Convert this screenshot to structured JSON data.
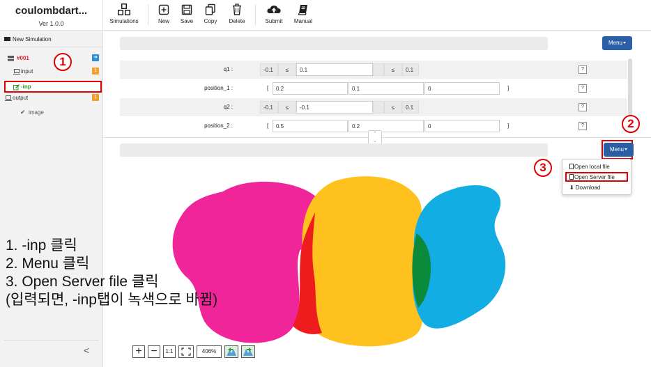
{
  "app": {
    "title": "coulombdart...",
    "version": "Ver 1.0.0"
  },
  "toolbar": [
    {
      "label": "Simulations",
      "icon": "cubes-icon"
    },
    {
      "label": "New",
      "icon": "plus-square-icon"
    },
    {
      "label": "Save",
      "icon": "floppy-icon"
    },
    {
      "label": "Copy",
      "icon": "copy-icon"
    },
    {
      "label": "Delete",
      "icon": "trash-icon"
    },
    {
      "label": "Submit",
      "icon": "cloud-upload-icon"
    },
    {
      "label": "Manual",
      "icon": "book-icon"
    }
  ],
  "sidebar": {
    "new_simulation": "New Simulation",
    "sim_id": "#001",
    "input_label": "input",
    "input_badge": "1",
    "inp_label": "-inp",
    "output_label": "output",
    "output_badge": "1",
    "image_label": "image",
    "collapse": "<"
  },
  "callouts": {
    "one": "1",
    "two": "2",
    "three": "3"
  },
  "params": {
    "menu": "Menu",
    "rows": [
      {
        "label": "q1 :",
        "min": "-0.1",
        "le1": "≤",
        "value": "0.1",
        "le2": "≤",
        "max": "0.1",
        "help": "?"
      },
      {
        "label": "position_1 :",
        "open": "[",
        "x": "0.2",
        "y": "0.1",
        "z": "0",
        "close": "]",
        "help": "?"
      },
      {
        "label": "q2 :",
        "min": "-0.1",
        "le1": "≤",
        "value": "-0.1",
        "le2": "≤",
        "max": "0.1",
        "help": "?"
      },
      {
        "label": "position_2 :",
        "open": "[",
        "x": "0.5",
        "y": "0.2",
        "z": "0",
        "close": "]",
        "help": "?"
      }
    ]
  },
  "viewer": {
    "menu": "Menu",
    "dropdown": [
      "Open local file",
      "Open Server file",
      "Download"
    ],
    "zoom": {
      "plus": "+",
      "minus": "−",
      "one_to_one": "1:1",
      "level": "406%"
    }
  },
  "colors": {
    "magenta": "#f0259a",
    "yellow": "#ffc11e",
    "cyan": "#12ade2",
    "red": "#ee1c1c",
    "green": "#0a8a3a",
    "accent": "#2a5fa5"
  },
  "instructions": [
    "1. -inp 클릭",
    "2. Menu 클릭",
    "3. Open Server file 클릭",
    "(입력되면, -inp탭이 녹색으로 바뀜)"
  ]
}
